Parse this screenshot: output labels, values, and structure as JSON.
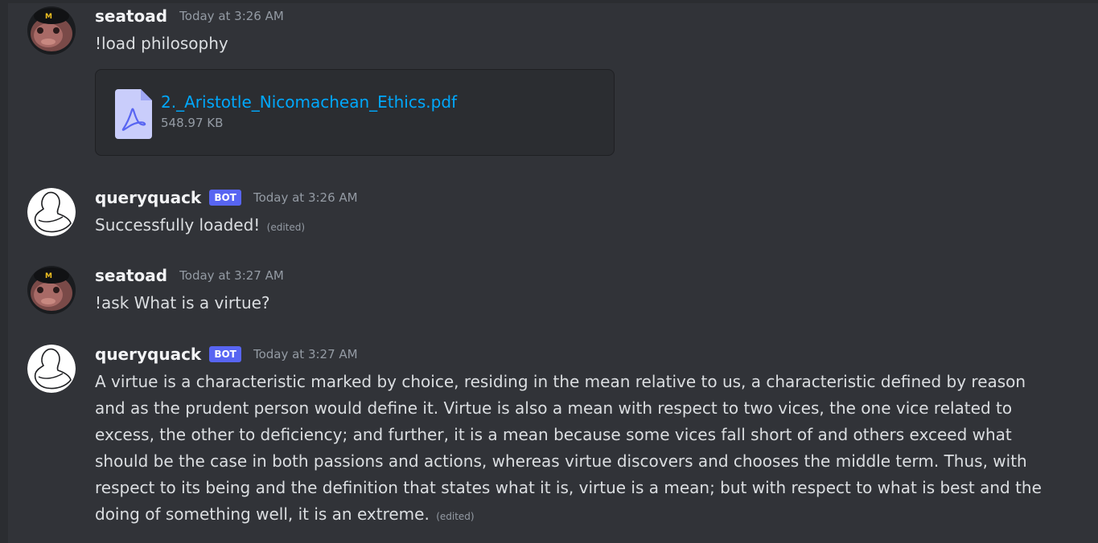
{
  "messages": [
    {
      "username": "seatoad",
      "timestamp": "Today at 3:26 AM",
      "text": "!load philosophy",
      "attachment": {
        "filename": "2._Aristotle_Nicomachean_Ethics.pdf",
        "size": "548.97 KB",
        "icon": "pdf-file-icon"
      }
    },
    {
      "username": "queryquack",
      "badge": "BOT",
      "timestamp": "Today at 3:26 AM",
      "text": "Successfully loaded!",
      "edited": "(edited)"
    },
    {
      "username": "seatoad",
      "timestamp": "Today at 3:27 AM",
      "text": "!ask What is a virtue?"
    },
    {
      "username": "queryquack",
      "badge": "BOT",
      "timestamp": "Today at 3:27 AM",
      "text": "A virtue is a characteristic marked by choice, residing in the mean relative to us, a characteristic defined by reason and as the prudent person would define it. Virtue is also a mean with respect to two vices, the one vice related to excess, the other to deficiency; and further, it is a mean because some vices fall short of and others exceed what should be the case in both passions and actions, whereas virtue discovers and chooses the middle term. Thus, with respect to its being and the definition that states what it is, virtue is a mean; but with respect to what is best and the doing of something well, it is an extreme.",
      "edited": "(edited)"
    }
  ],
  "colors": {
    "background": "#313338",
    "link": "#00a8fc",
    "bot_badge": "#5865f2",
    "text": "#dbdee1",
    "muted": "#949ba4"
  }
}
